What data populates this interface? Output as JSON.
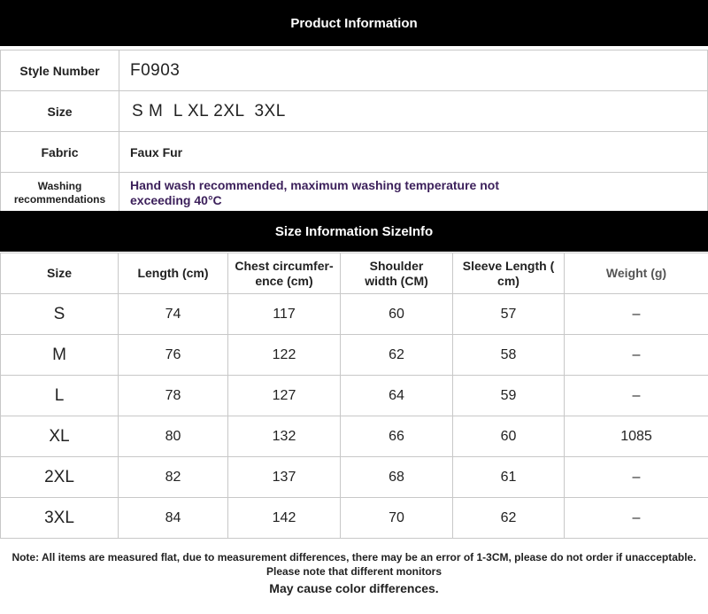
{
  "product_header": "Product Information",
  "info": {
    "style_label": "Style Number",
    "style_value": "F0903",
    "size_label": "Size",
    "size_value": "S M  L XL 2XL  3XL",
    "fabric_label": "Fabric",
    "fabric_value": "Faux Fur",
    "washing_label_1": "Washing",
    "washing_label_2": "recommendations",
    "washing_value_1": "Hand wash recommended, maximum washing temperature not",
    "washing_value_2": "exceeding 40°C"
  },
  "size_header": "Size Information SizeInfo",
  "columns": [
    [
      "Size",
      ""
    ],
    [
      "Length (cm)",
      ""
    ],
    [
      "Chest circumfer-",
      "ence (cm)"
    ],
    [
      "Shoulder",
      "width (CM)"
    ],
    [
      "Sleeve Length (",
      "cm)"
    ],
    [
      "Weight (g)",
      ""
    ]
  ],
  "rows": [
    [
      "S",
      "74",
      "117",
      "60",
      "57",
      "–"
    ],
    [
      "M",
      "76",
      "122",
      "62",
      "58",
      "–"
    ],
    [
      "L",
      "78",
      "127",
      "64",
      "59",
      "–"
    ],
    [
      "XL",
      "80",
      "132",
      "66",
      "60",
      "1085"
    ],
    [
      "2XL",
      "82",
      "137",
      "68",
      "61",
      "–"
    ],
    [
      "3XL",
      "84",
      "142",
      "70",
      "62",
      "–"
    ]
  ],
  "note": {
    "line1": "Note: All items are measured flat, due to measurement differences, there may be an error of 1-3CM, please do not order if unacceptable.",
    "line2": "Please note that different monitors",
    "line3": "May cause color differences."
  }
}
